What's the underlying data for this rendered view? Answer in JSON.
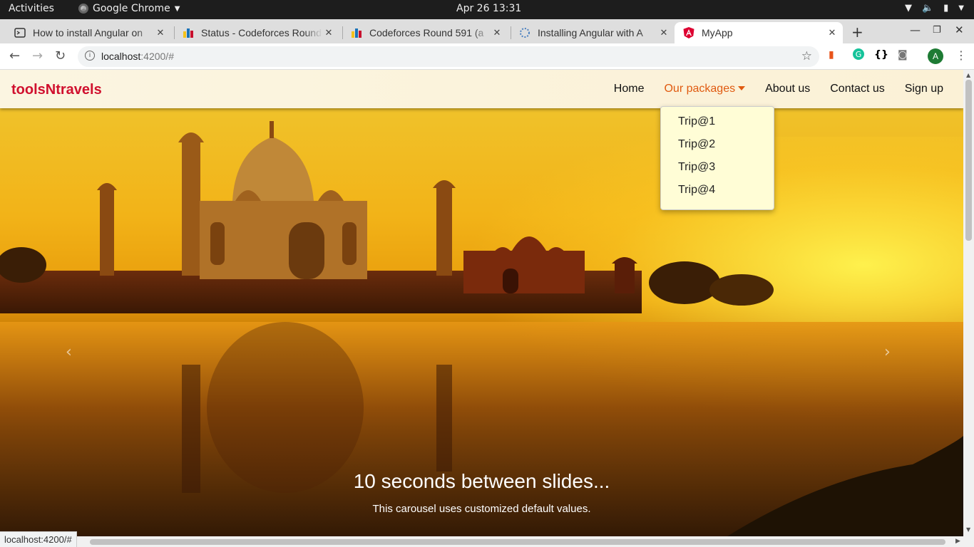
{
  "system": {
    "activities": "Activities",
    "app_name": "Google Chrome",
    "clock": "Apr 26  13:31"
  },
  "tabs": [
    {
      "title": "How to install Angular on",
      "icon": "terminal-icon"
    },
    {
      "title": "Status - Codeforces Round",
      "icon": "codeforces-icon"
    },
    {
      "title": "Codeforces Round 591 (a",
      "icon": "codeforces-icon"
    },
    {
      "title": "Installing Angular with A",
      "icon": "loading-icon"
    },
    {
      "title": "MyApp",
      "icon": "angular-icon",
      "active": true
    }
  ],
  "address": {
    "host": "localhost",
    "path": ":4200/#"
  },
  "profile": {
    "initial": "A"
  },
  "site": {
    "brand": "toolsNtravels",
    "nav": {
      "home": "Home",
      "packages": "Our packages",
      "about": "About us",
      "contact": "Contact us",
      "signup": "Sign up"
    },
    "dropdown": [
      "Trip@1",
      "Trip@2",
      "Trip@3",
      "Trip@4"
    ],
    "carousel": {
      "title": "10 seconds between slides...",
      "subtitle": "This carousel uses customized default values."
    }
  },
  "status_url": "localhost:4200/#",
  "colors": {
    "brand": "#d0102e",
    "nav_active": "#e05a10",
    "dropdown_bg": "#fffdd6"
  }
}
